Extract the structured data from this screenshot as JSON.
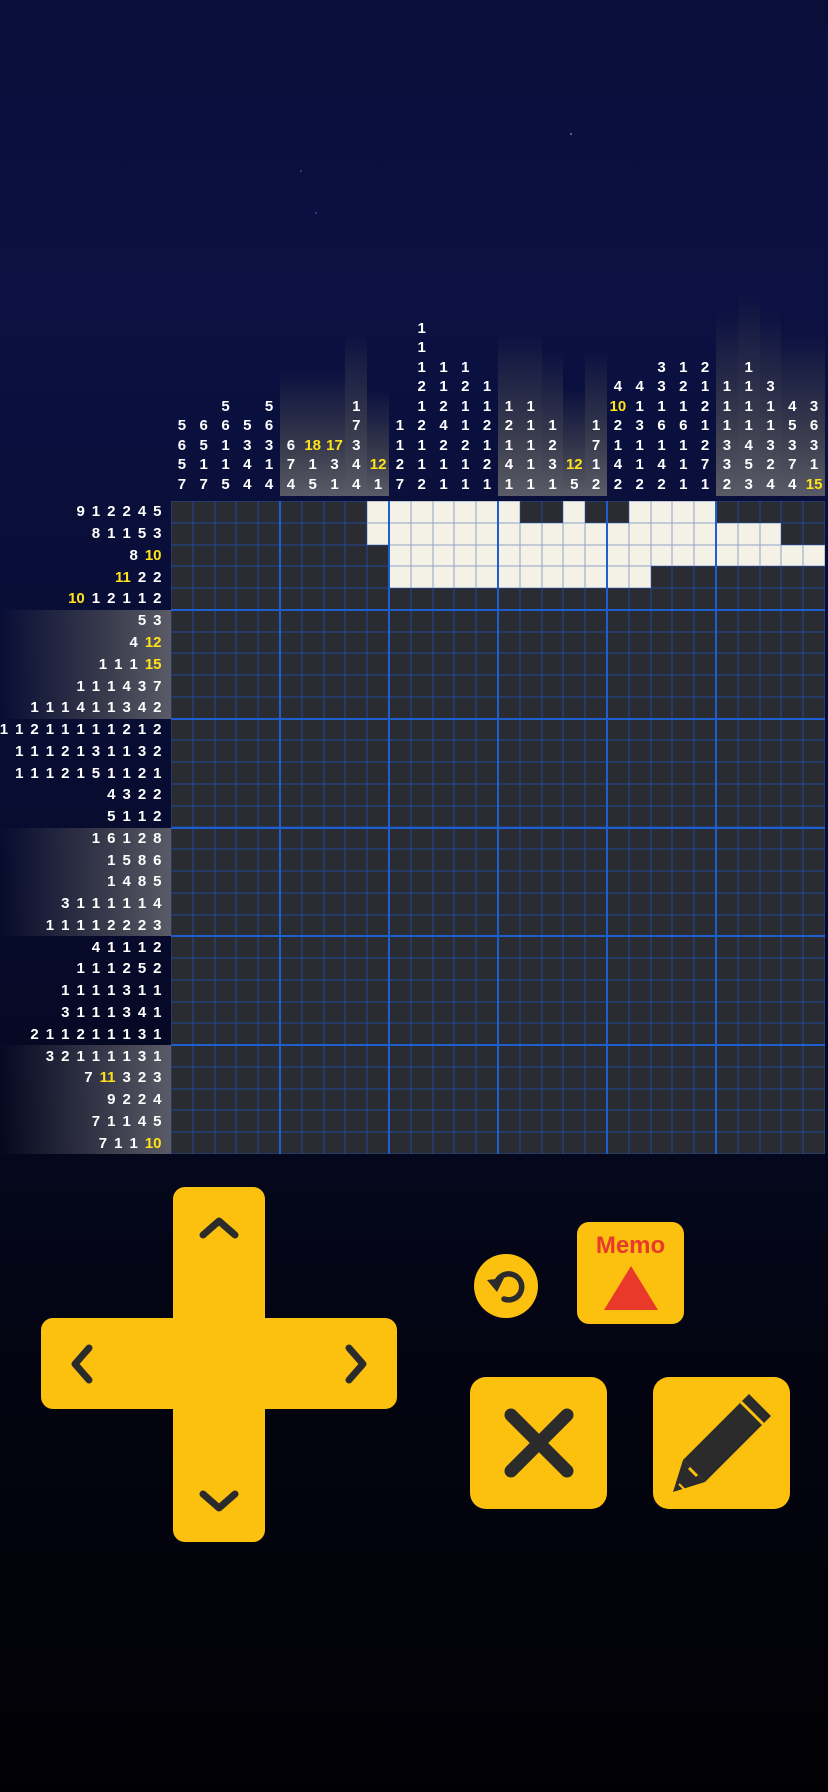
{
  "puzzle": {
    "size": 30,
    "column_clues": [
      [
        {
          "v": "5"
        },
        {
          "v": "6"
        },
        {
          "v": "5"
        },
        {
          "v": "7"
        }
      ],
      [
        {
          "v": "6"
        },
        {
          "v": "5"
        },
        {
          "v": "1"
        },
        {
          "v": "7"
        }
      ],
      [
        {
          "v": "5"
        },
        {
          "v": "6"
        },
        {
          "v": "1"
        },
        {
          "v": "1"
        },
        {
          "v": "5"
        }
      ],
      [
        {
          "v": "5"
        },
        {
          "v": "3"
        },
        {
          "v": "4"
        },
        {
          "v": "4"
        }
      ],
      [
        {
          "v": "5"
        },
        {
          "v": "6"
        },
        {
          "v": "3"
        },
        {
          "v": "1"
        },
        {
          "v": "4"
        }
      ],
      [
        {
          "v": "6"
        },
        {
          "v": "7"
        },
        {
          "v": "4"
        }
      ],
      [
        {
          "v": "18",
          "hl": true
        },
        {
          "v": "1"
        },
        {
          "v": "5"
        }
      ],
      [
        {
          "v": "17",
          "hl": true
        },
        {
          "v": "3"
        },
        {
          "v": "1"
        }
      ],
      [
        {
          "v": "1"
        },
        {
          "v": "7"
        },
        {
          "v": "3"
        },
        {
          "v": "4"
        },
        {
          "v": "4"
        }
      ],
      [
        {
          "v": "12",
          "hl": true
        },
        {
          "v": "1"
        }
      ],
      [
        {
          "v": "1"
        },
        {
          "v": "1"
        },
        {
          "v": "2"
        },
        {
          "v": "7"
        }
      ],
      [
        {
          "v": "1"
        },
        {
          "v": "1"
        },
        {
          "v": "1"
        },
        {
          "v": "2"
        },
        {
          "v": "1"
        },
        {
          "v": "2"
        },
        {
          "v": "1"
        },
        {
          "v": "1"
        },
        {
          "v": "2"
        }
      ],
      [
        {
          "v": "1"
        },
        {
          "v": "1"
        },
        {
          "v": "2"
        },
        {
          "v": "4"
        },
        {
          "v": "2"
        },
        {
          "v": "1"
        },
        {
          "v": "1"
        }
      ],
      [
        {
          "v": "1"
        },
        {
          "v": "2"
        },
        {
          "v": "1"
        },
        {
          "v": "1"
        },
        {
          "v": "2"
        },
        {
          "v": "1"
        },
        {
          "v": "1"
        }
      ],
      [
        {
          "v": "1"
        },
        {
          "v": "1"
        },
        {
          "v": "2"
        },
        {
          "v": "1"
        },
        {
          "v": "2"
        },
        {
          "v": "1"
        }
      ],
      [
        {
          "v": "1"
        },
        {
          "v": "2"
        },
        {
          "v": "1"
        },
        {
          "v": "4"
        },
        {
          "v": "1"
        }
      ],
      [
        {
          "v": "1"
        },
        {
          "v": "1"
        },
        {
          "v": "1"
        },
        {
          "v": "1"
        },
        {
          "v": "1"
        }
      ],
      [
        {
          "v": "1"
        },
        {
          "v": "2"
        },
        {
          "v": "3"
        },
        {
          "v": "1"
        }
      ],
      [
        {
          "v": "12",
          "hl": true
        },
        {
          "v": "5"
        }
      ],
      [
        {
          "v": "1"
        },
        {
          "v": "7"
        },
        {
          "v": "1"
        },
        {
          "v": "2"
        }
      ],
      [
        {
          "v": "4"
        },
        {
          "v": "10",
          "hl": true
        },
        {
          "v": "2"
        },
        {
          "v": "1"
        },
        {
          "v": "4"
        },
        {
          "v": "2"
        }
      ],
      [
        {
          "v": "4"
        },
        {
          "v": "1"
        },
        {
          "v": "3"
        },
        {
          "v": "1"
        },
        {
          "v": "1"
        },
        {
          "v": "2"
        }
      ],
      [
        {
          "v": "3"
        },
        {
          "v": "3"
        },
        {
          "v": "1"
        },
        {
          "v": "6"
        },
        {
          "v": "1"
        },
        {
          "v": "4"
        },
        {
          "v": "2"
        }
      ],
      [
        {
          "v": "1"
        },
        {
          "v": "2"
        },
        {
          "v": "1"
        },
        {
          "v": "6"
        },
        {
          "v": "1"
        },
        {
          "v": "1"
        },
        {
          "v": "1"
        }
      ],
      [
        {
          "v": "2"
        },
        {
          "v": "1"
        },
        {
          "v": "2"
        },
        {
          "v": "1"
        },
        {
          "v": "2"
        },
        {
          "v": "7"
        },
        {
          "v": "1"
        }
      ],
      [
        {
          "v": "1"
        },
        {
          "v": "1"
        },
        {
          "v": "1"
        },
        {
          "v": "3"
        },
        {
          "v": "3"
        },
        {
          "v": "2"
        }
      ],
      [
        {
          "v": "1"
        },
        {
          "v": "1"
        },
        {
          "v": "1"
        },
        {
          "v": "1"
        },
        {
          "v": "4"
        },
        {
          "v": "5"
        },
        {
          "v": "3"
        }
      ],
      [
        {
          "v": "3"
        },
        {
          "v": "1"
        },
        {
          "v": "1"
        },
        {
          "v": "3"
        },
        {
          "v": "2"
        },
        {
          "v": "4"
        }
      ],
      [
        {
          "v": "4"
        },
        {
          "v": "5"
        },
        {
          "v": "3"
        },
        {
          "v": "7"
        },
        {
          "v": "4"
        }
      ],
      [
        {
          "v": "3"
        },
        {
          "v": "6"
        },
        {
          "v": "3"
        },
        {
          "v": "1"
        },
        {
          "v": "15",
          "hl": true
        }
      ]
    ],
    "row_clues": [
      [
        {
          "v": "9"
        },
        {
          "v": "1"
        },
        {
          "v": "2"
        },
        {
          "v": "2"
        },
        {
          "v": "4"
        },
        {
          "v": "5"
        }
      ],
      [
        {
          "v": "8"
        },
        {
          "v": "1"
        },
        {
          "v": "1"
        },
        {
          "v": "5"
        },
        {
          "v": "3"
        }
      ],
      [
        {
          "v": "8"
        },
        {
          "v": "10",
          "hl": true
        }
      ],
      [
        {
          "v": "11",
          "hl": true
        },
        {
          "v": "2"
        },
        {
          "v": "2"
        }
      ],
      [
        {
          "v": "10",
          "hl": true
        },
        {
          "v": "1"
        },
        {
          "v": "2"
        },
        {
          "v": "1"
        },
        {
          "v": "1"
        },
        {
          "v": "2"
        }
      ],
      [
        {
          "v": "5"
        },
        {
          "v": "3"
        }
      ],
      [
        {
          "v": "4"
        },
        {
          "v": "12",
          "hl": true
        }
      ],
      [
        {
          "v": "1"
        },
        {
          "v": "1"
        },
        {
          "v": "1"
        },
        {
          "v": "15",
          "hl": true
        }
      ],
      [
        {
          "v": "1"
        },
        {
          "v": "1"
        },
        {
          "v": "1"
        },
        {
          "v": "4"
        },
        {
          "v": "3"
        },
        {
          "v": "7"
        }
      ],
      [
        {
          "v": "1"
        },
        {
          "v": "1"
        },
        {
          "v": "1"
        },
        {
          "v": "4"
        },
        {
          "v": "1"
        },
        {
          "v": "1"
        },
        {
          "v": "3"
        },
        {
          "v": "4"
        },
        {
          "v": "2"
        }
      ],
      [
        {
          "v": "1"
        },
        {
          "v": "1"
        },
        {
          "v": "1"
        },
        {
          "v": "2"
        },
        {
          "v": "1"
        },
        {
          "v": "1"
        },
        {
          "v": "1"
        },
        {
          "v": "1"
        },
        {
          "v": "1"
        },
        {
          "v": "2"
        },
        {
          "v": "1"
        },
        {
          "v": "2"
        }
      ],
      [
        {
          "v": "1"
        },
        {
          "v": "1"
        },
        {
          "v": "1"
        },
        {
          "v": "2"
        },
        {
          "v": "1"
        },
        {
          "v": "3"
        },
        {
          "v": "1"
        },
        {
          "v": "1"
        },
        {
          "v": "3"
        },
        {
          "v": "2"
        }
      ],
      [
        {
          "v": "1"
        },
        {
          "v": "1"
        },
        {
          "v": "1"
        },
        {
          "v": "2"
        },
        {
          "v": "1"
        },
        {
          "v": "5"
        },
        {
          "v": "1"
        },
        {
          "v": "1"
        },
        {
          "v": "2"
        },
        {
          "v": "1"
        }
      ],
      [
        {
          "v": "4"
        },
        {
          "v": "3"
        },
        {
          "v": "2"
        },
        {
          "v": "2"
        }
      ],
      [
        {
          "v": "5"
        },
        {
          "v": "1"
        },
        {
          "v": "1"
        },
        {
          "v": "2"
        }
      ],
      [
        {
          "v": "1"
        },
        {
          "v": "6"
        },
        {
          "v": "1"
        },
        {
          "v": "2"
        },
        {
          "v": "8"
        }
      ],
      [
        {
          "v": "1"
        },
        {
          "v": "5"
        },
        {
          "v": "8"
        },
        {
          "v": "6"
        }
      ],
      [
        {
          "v": "1"
        },
        {
          "v": "4"
        },
        {
          "v": "8"
        },
        {
          "v": "5"
        }
      ],
      [
        {
          "v": "3"
        },
        {
          "v": "1"
        },
        {
          "v": "1"
        },
        {
          "v": "1"
        },
        {
          "v": "1"
        },
        {
          "v": "1"
        },
        {
          "v": "4"
        }
      ],
      [
        {
          "v": "1"
        },
        {
          "v": "1"
        },
        {
          "v": "1"
        },
        {
          "v": "1"
        },
        {
          "v": "2"
        },
        {
          "v": "2"
        },
        {
          "v": "2"
        },
        {
          "v": "3"
        }
      ],
      [
        {
          "v": "4"
        },
        {
          "v": "1"
        },
        {
          "v": "1"
        },
        {
          "v": "1"
        },
        {
          "v": "2"
        }
      ],
      [
        {
          "v": "1"
        },
        {
          "v": "1"
        },
        {
          "v": "1"
        },
        {
          "v": "2"
        },
        {
          "v": "5"
        },
        {
          "v": "2"
        }
      ],
      [
        {
          "v": "1"
        },
        {
          "v": "1"
        },
        {
          "v": "1"
        },
        {
          "v": "1"
        },
        {
          "v": "3"
        },
        {
          "v": "1"
        },
        {
          "v": "1"
        }
      ],
      [
        {
          "v": "3"
        },
        {
          "v": "1"
        },
        {
          "v": "1"
        },
        {
          "v": "1"
        },
        {
          "v": "3"
        },
        {
          "v": "4"
        },
        {
          "v": "1"
        }
      ],
      [
        {
          "v": "2"
        },
        {
          "v": "1"
        },
        {
          "v": "1"
        },
        {
          "v": "2"
        },
        {
          "v": "1"
        },
        {
          "v": "1"
        },
        {
          "v": "1"
        },
        {
          "v": "3"
        },
        {
          "v": "1"
        }
      ],
      [
        {
          "v": "3"
        },
        {
          "v": "2"
        },
        {
          "v": "1"
        },
        {
          "v": "1"
        },
        {
          "v": "1"
        },
        {
          "v": "1"
        },
        {
          "v": "3"
        },
        {
          "v": "1"
        }
      ],
      [
        {
          "v": "7"
        },
        {
          "v": "11",
          "hl": true
        },
        {
          "v": "3"
        },
        {
          "v": "2"
        },
        {
          "v": "3"
        }
      ],
      [
        {
          "v": "9"
        },
        {
          "v": "2"
        },
        {
          "v": "2"
        },
        {
          "v": "4"
        }
      ],
      [
        {
          "v": "7"
        },
        {
          "v": "1"
        },
        {
          "v": "1"
        },
        {
          "v": "4"
        },
        {
          "v": "5"
        }
      ],
      [
        {
          "v": "7"
        },
        {
          "v": "1"
        },
        {
          "v": "1"
        },
        {
          "v": "10",
          "hl": true
        }
      ]
    ],
    "grid_rows": [
      "000000000111111100100111100000",
      "000000000111111111111111111100",
      "000000000011111111111111111111",
      "000000000011111111111100000000",
      "000000000000000000000000000000",
      "000000000000000000000000000000",
      "000000000000000000000000000000",
      "000000000000000000000000000000",
      "000000000000000000000000000000",
      "000000000000000000000000000000",
      "000000000000000000000000000000",
      "000000000000000000000000000000",
      "000000000000000000000000000000",
      "000000000000000000000000000000",
      "000000000000000000000000000000",
      "000000000000000000000000000000",
      "000000000000000000000000000000",
      "000000000000000000000000000000",
      "000000000000000000000000000000",
      "000000000000000000000000000000",
      "000000000000000000000000000000",
      "000000000000000000000000000000",
      "000000000000000000000000000000",
      "000000000000000000000000000000",
      "000000000000000000000000000000",
      "000000000000000000000000000000",
      "000000000000000000000000000000",
      "000000000000000000000000000000",
      "000000000000000000000000000000",
      "000000000000000000000000000000"
    ],
    "shaded_columns": [
      5,
      6,
      7,
      8,
      9,
      15,
      16,
      17,
      18,
      19,
      25,
      26,
      27,
      28,
      29
    ],
    "shaded_rows": [
      5,
      6,
      7,
      8,
      9,
      15,
      16,
      17,
      18,
      19,
      25,
      26,
      27,
      28,
      29
    ]
  },
  "controls": {
    "memo_label": "Memo",
    "up_icon": "chevron-up-icon",
    "down_icon": "chevron-down-icon",
    "left_icon": "chevron-left-icon",
    "right_icon": "chevron-right-icon",
    "undo_icon": "undo-icon",
    "cross_icon": "cross-icon",
    "pencil_icon": "pencil-icon",
    "accent_color": "#fcc00f",
    "memo_text_color": "#e8392b"
  }
}
